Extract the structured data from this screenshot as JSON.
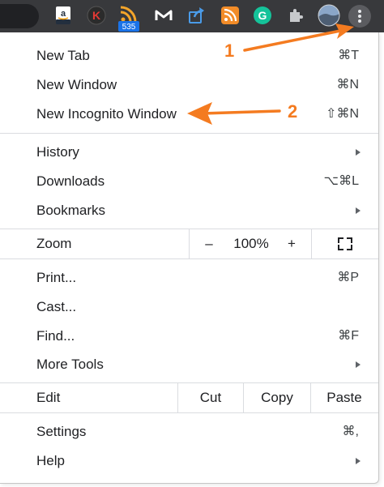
{
  "toolbar": {
    "extensions": [
      {
        "name": "amazon-assistant-icon",
        "glyph": "a"
      },
      {
        "name": "k-extension-icon",
        "glyph": "K"
      },
      {
        "name": "rss-feed-icon",
        "badge": "535"
      },
      {
        "name": "m-extension-icon",
        "glyph": "M"
      },
      {
        "name": "share-extension-icon"
      },
      {
        "name": "rss-extension-icon"
      },
      {
        "name": "grammarly-icon",
        "glyph": "G"
      },
      {
        "name": "extensions-puzzle-icon"
      },
      {
        "name": "profile-avatar-icon"
      },
      {
        "name": "kebab-menu-icon"
      }
    ]
  },
  "menu": {
    "new_tab": {
      "label": "New Tab",
      "shortcut": "⌘T"
    },
    "new_window": {
      "label": "New Window",
      "shortcut": "⌘N"
    },
    "new_incognito": {
      "label": "New Incognito Window",
      "shortcut": "⇧⌘N"
    },
    "history": {
      "label": "History"
    },
    "downloads": {
      "label": "Downloads",
      "shortcut": "⌥⌘L"
    },
    "bookmarks": {
      "label": "Bookmarks"
    },
    "zoom": {
      "label": "Zoom",
      "minus": "–",
      "level": "100%",
      "plus": "+"
    },
    "print": {
      "label": "Print...",
      "shortcut": "⌘P"
    },
    "cast": {
      "label": "Cast..."
    },
    "find": {
      "label": "Find...",
      "shortcut": "⌘F"
    },
    "more_tools": {
      "label": "More Tools"
    },
    "edit": {
      "label": "Edit",
      "cut": "Cut",
      "copy": "Copy",
      "paste": "Paste"
    },
    "settings": {
      "label": "Settings",
      "shortcut": "⌘,"
    },
    "help": {
      "label": "Help"
    }
  },
  "annotations": {
    "step1": "1",
    "step2": "2"
  },
  "colors": {
    "toolbar_bg": "#38393c",
    "annotation": "#f47b20",
    "badge": "#1a73e8"
  }
}
